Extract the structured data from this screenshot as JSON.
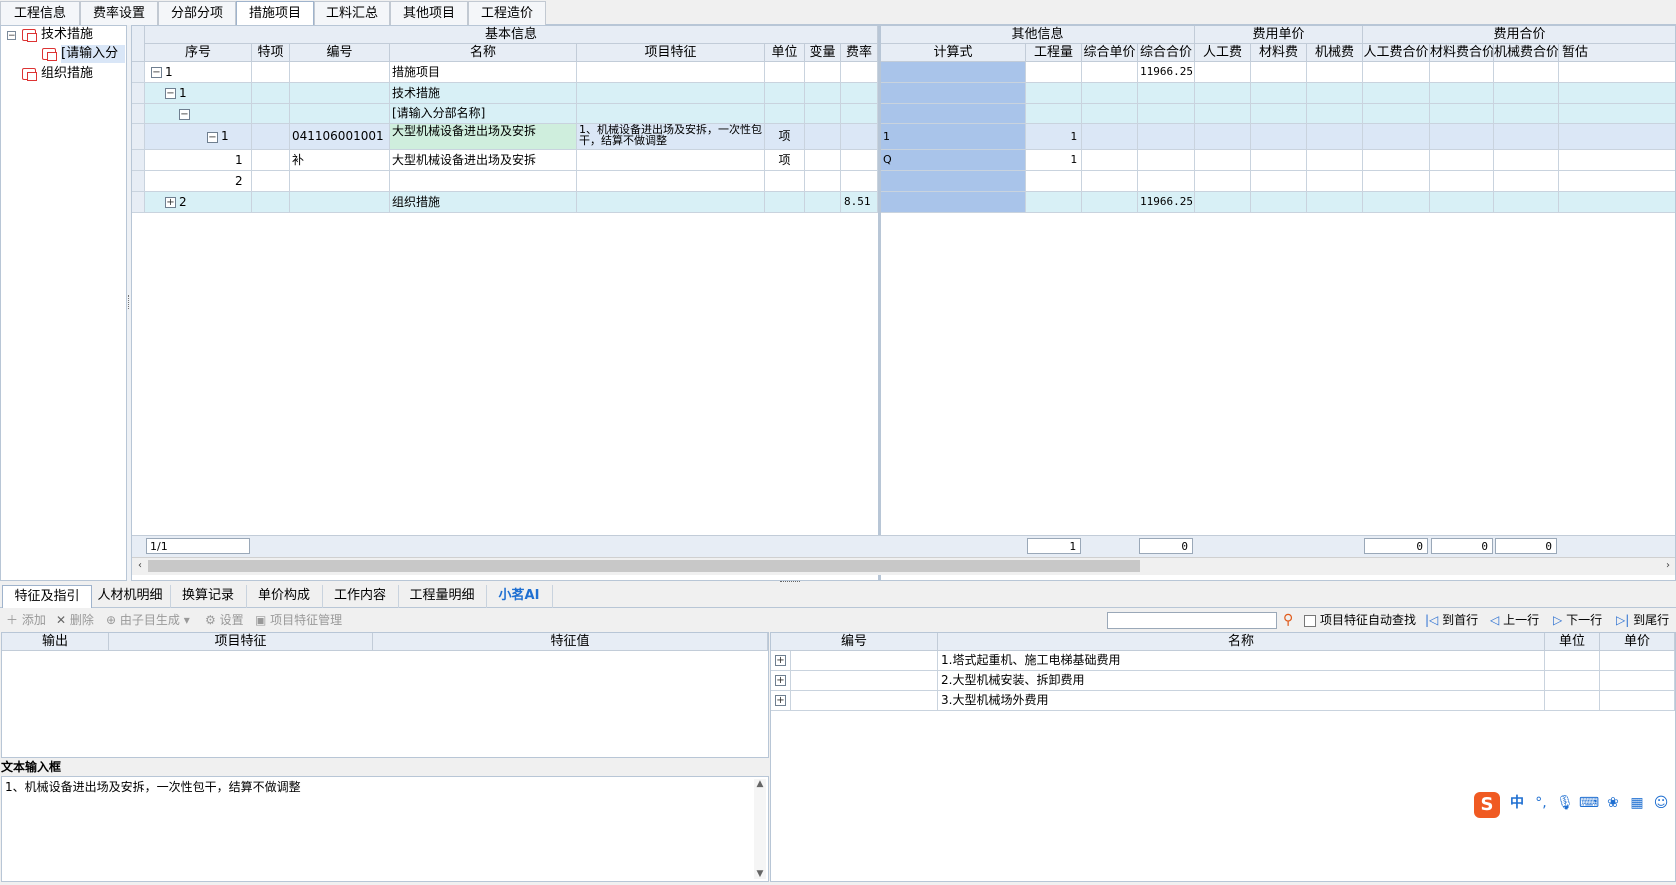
{
  "top_tabs": [
    "工程信息",
    "费率设置",
    "分部分项",
    "措施项目",
    "工料汇总",
    "其他项目",
    "工程造价"
  ],
  "active_top_tab": "措施项目",
  "tree": {
    "items": [
      {
        "label": "技术措施"
      },
      {
        "label": "[请输入分"
      },
      {
        "label": "组织措施"
      }
    ]
  },
  "grid": {
    "group_headers": {
      "basic": "基本信息",
      "other": "其他信息",
      "unit_price": "费用单价",
      "total_price": "费用合价"
    },
    "columns": [
      "序号",
      "特项",
      "编号",
      "名称",
      "项目特征",
      "单位",
      "变量",
      "费率",
      "计算式",
      "工程量",
      "综合单价",
      "综合合价",
      "人工费",
      "材料费",
      "机械费",
      "人工费合价",
      "材料费合价",
      "机械费合价",
      "暂估"
    ],
    "rows": [
      {
        "seq": "1",
        "code": "",
        "name": "措施项目",
        "feature": "",
        "unit": "",
        "rate": "",
        "formula": "",
        "qty": "",
        "total": "11966.25"
      },
      {
        "seq": "1",
        "code": "",
        "name": "技术措施",
        "feature": "",
        "unit": "",
        "rate": "",
        "formula": "",
        "qty": "",
        "total": ""
      },
      {
        "seq": "",
        "code": "",
        "name": "[请输入分部名称]",
        "feature": "",
        "unit": "",
        "rate": "",
        "formula": "",
        "qty": "",
        "total": ""
      },
      {
        "seq": "1",
        "code": "041106001001",
        "name": "大型机械设备进出场及安拆",
        "feature": "1、机械设备进出场及安拆，一次性包干，结算不做调整",
        "unit": "项",
        "rate": "",
        "formula": "1",
        "qty": "1",
        "total": ""
      },
      {
        "seq": "1",
        "code": "补",
        "name": "大型机械设备进出场及安拆",
        "feature": "",
        "unit": "项",
        "rate": "",
        "formula": "Q",
        "qty": "1",
        "total": ""
      },
      {
        "seq": "2",
        "code": "",
        "name": "",
        "feature": "",
        "unit": "",
        "rate": "",
        "formula": "",
        "qty": "",
        "total": ""
      },
      {
        "seq": "2",
        "code": "",
        "name": "组织措施",
        "feature": "",
        "unit": "",
        "rate": "8.51",
        "formula": "",
        "qty": "",
        "total": "11966.25"
      }
    ],
    "footer": {
      "page": "1/1",
      "qty": "1",
      "total": "0",
      "labor": "0",
      "material": "0",
      "machine": "0"
    }
  },
  "bottom_tabs": [
    "特征及指引",
    "人材机明细",
    "换算记录",
    "单价构成",
    "工作内容",
    "工程量明细",
    "小茗AI"
  ],
  "active_bottom_tab": "特征及指引",
  "toolbar": {
    "add": "添加",
    "delete": "删除",
    "gen_sub": "由子目生成",
    "settings": "设置",
    "feature_mgmt": "项目特征管理",
    "auto_find": "项目特征自动查找",
    "first": "到首行",
    "prev": "上一行",
    "next": "下一行",
    "last": "到尾行",
    "search_value": ""
  },
  "left_table": {
    "headers": [
      "输出",
      "项目特征",
      "特征值"
    ]
  },
  "text_input": {
    "label": "文本输入框",
    "value": "1、机械设备进出场及安拆，一次性包干，结算不做调整"
  },
  "right_table": {
    "headers": [
      "编号",
      "名称",
      "单位",
      "单价"
    ],
    "rows": [
      {
        "name": "1.塔式起重机、施工电梯基础费用"
      },
      {
        "name": "2.大型机械安装、拆卸费用"
      },
      {
        "name": "3.大型机械场外费用"
      }
    ]
  },
  "ime": {
    "logo": "S",
    "lang": "中"
  },
  "colors": {
    "header": "#e7edf5",
    "row_cyan": "#d8f0f6",
    "row_sel": "#dbe7f6",
    "formula_blue": "#a9c4ea",
    "name_green": "#cfeedd",
    "accent": "#1f6fd1"
  }
}
